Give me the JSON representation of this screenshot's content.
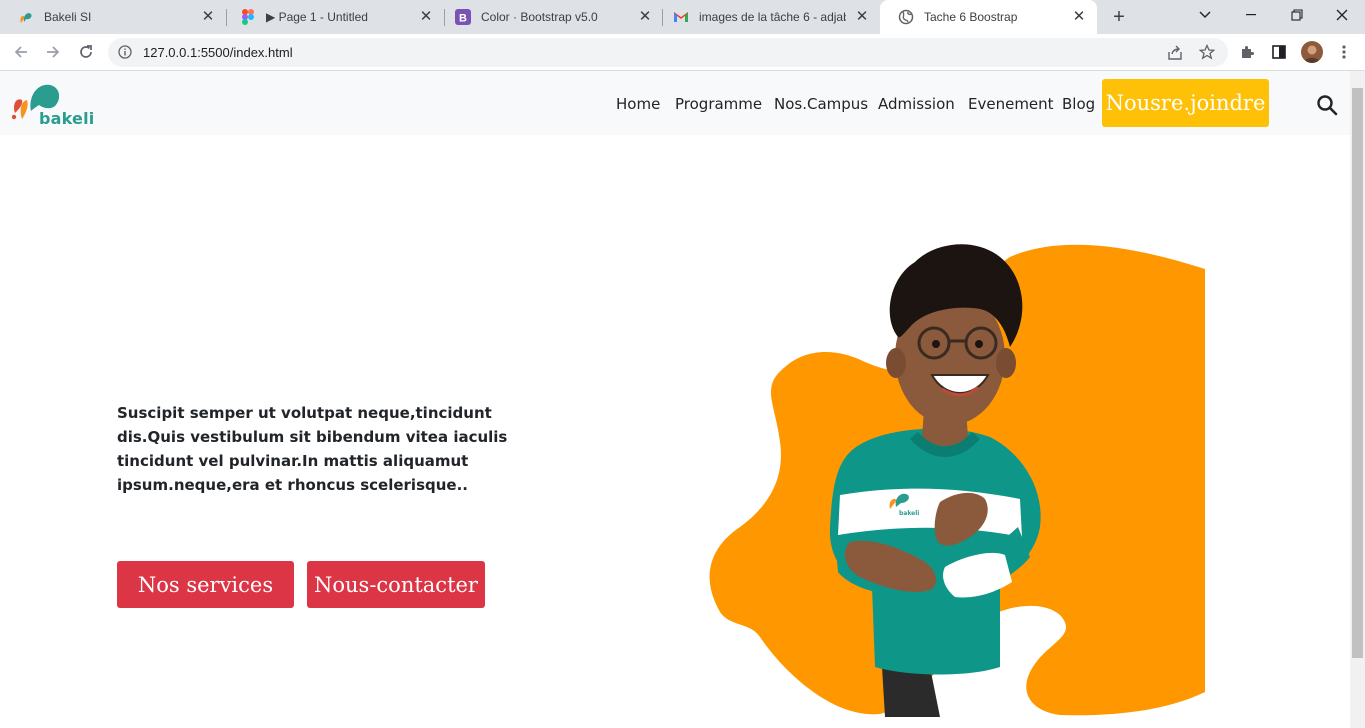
{
  "browser": {
    "tabs": [
      {
        "title": "Bakeli SI",
        "icon": "bakeli-favicon"
      },
      {
        "title": "▶ Page 1 - Untitled",
        "icon": "figma-favicon"
      },
      {
        "title": "Color · Bootstrap v5.0",
        "icon": "bootstrap-favicon"
      },
      {
        "title": "images de la tâche 6 - adjabi",
        "icon": "gmail-favicon"
      },
      {
        "title": "Tache 6 Boostrap",
        "icon": "globe-favicon"
      }
    ],
    "active_tab": 4,
    "url": "127.0.0.1:5500/index.html"
  },
  "navbar": {
    "logo_text": "bakeli",
    "links": [
      "Home",
      "Programme",
      "Nos.Campus",
      "Admission",
      "Evenement",
      "Blog"
    ],
    "join_label": "Nousre.joindre"
  },
  "hero": {
    "text": "Suscipit semper ut volutpat neque,tincidunt dis.Quis vestibulum sit bibendum vitea iaculis tincidunt vel pulvinar.In mattis aliquamut ipsum.neque,era et rhoncus scelerisque..",
    "services_label": "Nos services",
    "contact_label": "Nous-contacter",
    "shirt_logo_text": "bakeli"
  },
  "colors": {
    "brand_teal": "#2a9d8f",
    "accent_yellow": "#ffc107",
    "button_red": "#dc3545",
    "blob_orange": "#ff9800"
  }
}
